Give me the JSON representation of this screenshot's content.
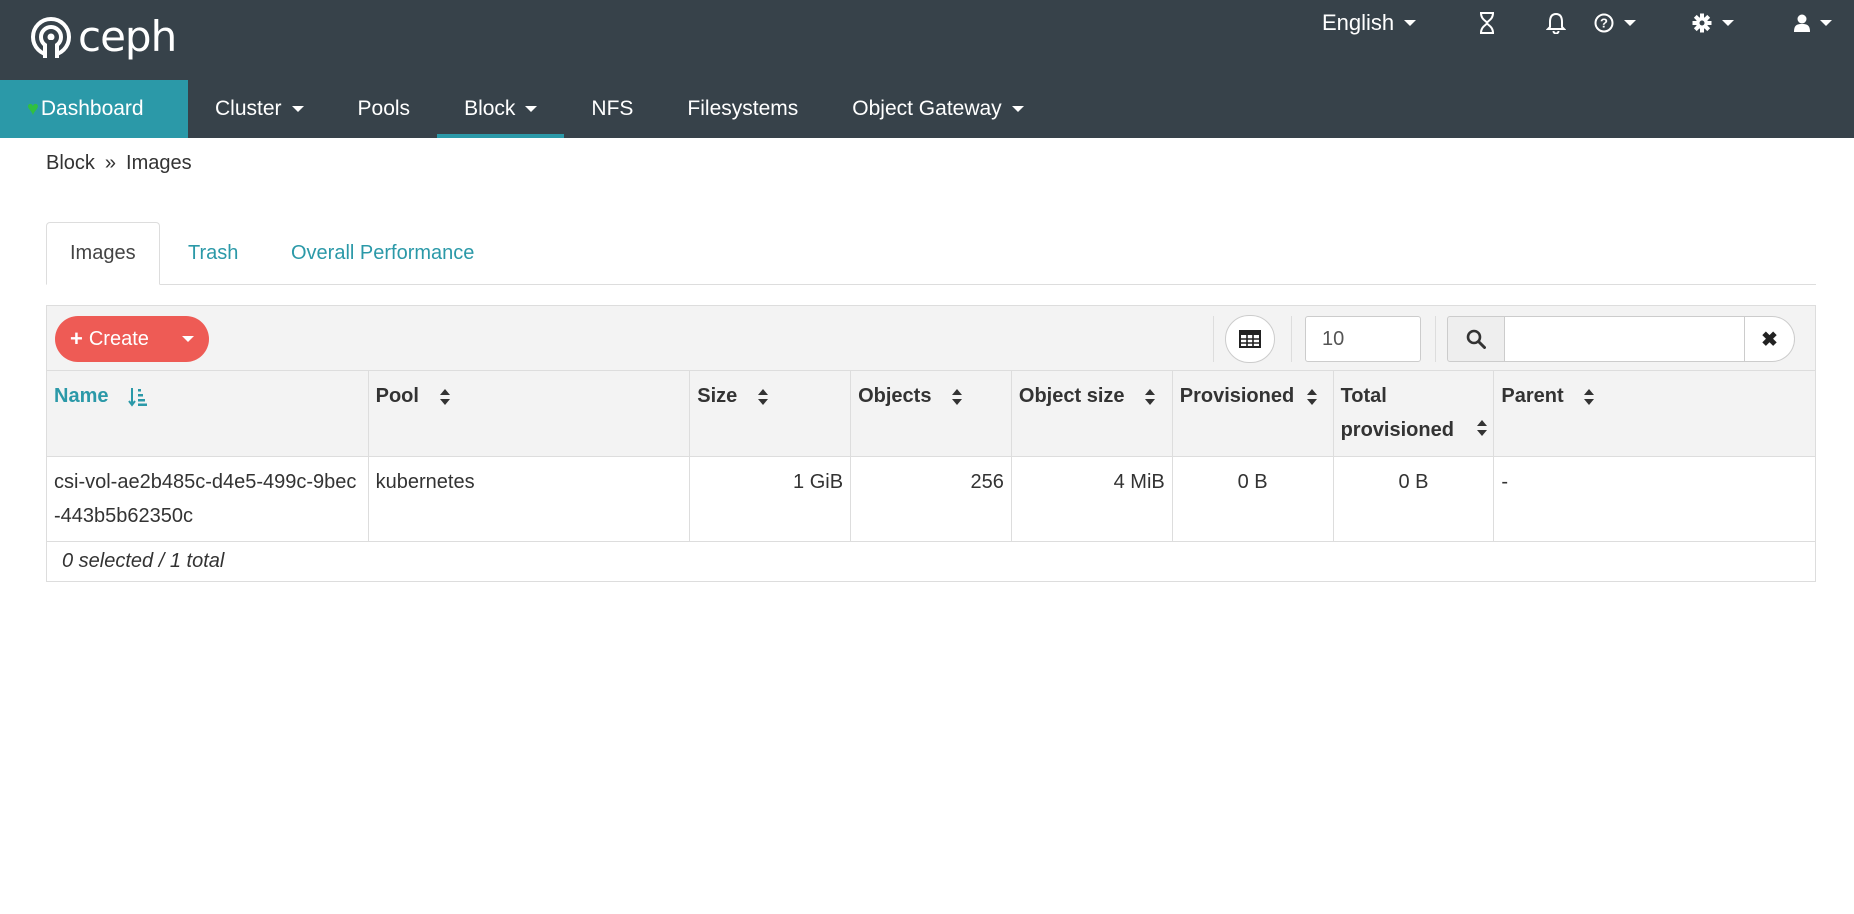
{
  "brand": {
    "name": "ceph"
  },
  "utility": {
    "language": "English"
  },
  "nav": {
    "items": [
      {
        "label": "Dashboard",
        "active": true
      },
      {
        "label": "Cluster",
        "dropdown": true
      },
      {
        "label": "Pools"
      },
      {
        "label": "Block",
        "dropdown": true,
        "current": true
      },
      {
        "label": "NFS"
      },
      {
        "label": "Filesystems"
      },
      {
        "label": "Object Gateway",
        "dropdown": true
      }
    ]
  },
  "breadcrumb": {
    "parent": "Block",
    "current": "Images"
  },
  "tabs": [
    {
      "label": "Images",
      "active": true
    },
    {
      "label": "Trash"
    },
    {
      "label": "Overall Performance"
    }
  ],
  "toolbar": {
    "create_label": "Create",
    "page_size": "10",
    "search_placeholder": "",
    "clear_icon": "✖"
  },
  "table": {
    "columns": [
      "Name",
      "Pool",
      "Size",
      "Objects",
      "Object size",
      "Provisioned",
      "Total provisioned",
      "Parent"
    ],
    "rows": [
      {
        "name": "csi-vol-ae2b485c-d4e5-499c-9bec-443b5b62350c",
        "pool": "kubernetes",
        "size": "1 GiB",
        "objects": "256",
        "object_size": "4 MiB",
        "provisioned": "0 B",
        "total_provisioned": "0 B",
        "parent": "-"
      }
    ],
    "footer": "0 selected / 1 total"
  },
  "colors": {
    "header_bg": "#37424a",
    "accent": "#2b99a8",
    "create_btn": "#ee5b55"
  }
}
